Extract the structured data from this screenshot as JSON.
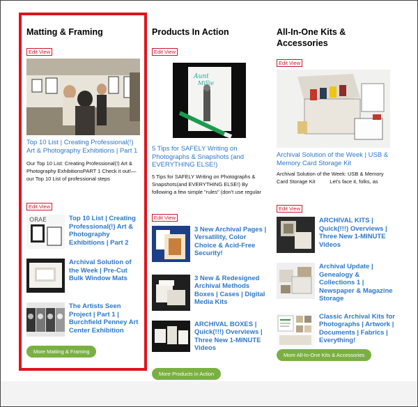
{
  "columns": [
    {
      "title": "Matting & Framing",
      "edit_label": "Edit View",
      "featured": {
        "title": "Top 10 List | Creating Professional(!) Art & Photography Exhibitions | Part 1",
        "excerpt": "Our Top 10 List: Creating Professional(!) Art & Photography ExhibitionsPART 1 Check it out!—our Top 10 List of professional steps"
      },
      "list_edit_label": "Edit View",
      "list": [
        {
          "title": "Top 10 List | Creating Professional(!) Art & Photography Exhibitions | Part 2"
        },
        {
          "title": "Archival Solution of the Week | Pre-Cut Bulk Window Mats"
        },
        {
          "title": "The Artists Seen Project | Part 1 | Burchfield Penney Art Center Exhibition"
        }
      ],
      "more_label": "More Matting & Framing"
    },
    {
      "title": "Products In Action",
      "edit_label": "Edit View",
      "featured": {
        "title": "5 Tips for SAFELY Writing on Photographs & Snapshots (and EVERYTHING ELSE!)",
        "excerpt": "5 Tips for SAFELY Writing on Photographs & Snapshots(and EVERYTHING ELSE!) By following a few simple \"rules\" (don't use regular"
      },
      "list_edit_label": "Edit View",
      "list": [
        {
          "title": "3 New Archival Pages | Versatility, Color Choice & Acid-Free Security!"
        },
        {
          "title": "3 New & Redesigned Archival Methods Boxes | Cases | Digital Media Kits"
        },
        {
          "title": "ARCHIVAL BOXES | Quick(!!!) Overviews | Three New 1-MINUTE Videos"
        }
      ],
      "more_label": "More Products in Action"
    },
    {
      "title": "All-In-One Kits & Accessories",
      "edit_label": "Edit View",
      "featured": {
        "title": "Archival Solution of the Week | USB & Memory Card Storage Kit",
        "excerpt": "Archival Solution of the Week: USB & Memory Card Storage Kit          Let's face it, folks, as"
      },
      "list_edit_label": "Edit View",
      "list": [
        {
          "title": "ARCHIVAL KITS | Quick(!!!) Overviews | Three New 1-MINUTE Videos"
        },
        {
          "title": "Archival Update | Genealogy & Collections 1 | Newspaper & Magazine Storage"
        },
        {
          "title": "Classic Archival Kits for Photographs | Artwork | Documents | Fabrics | Everything!"
        }
      ],
      "more_label": "More All-In-One Kits & Accessories"
    }
  ],
  "colors": {
    "link": "#2c77c9",
    "highlight": "#e0131c",
    "button": "#7ab041"
  }
}
